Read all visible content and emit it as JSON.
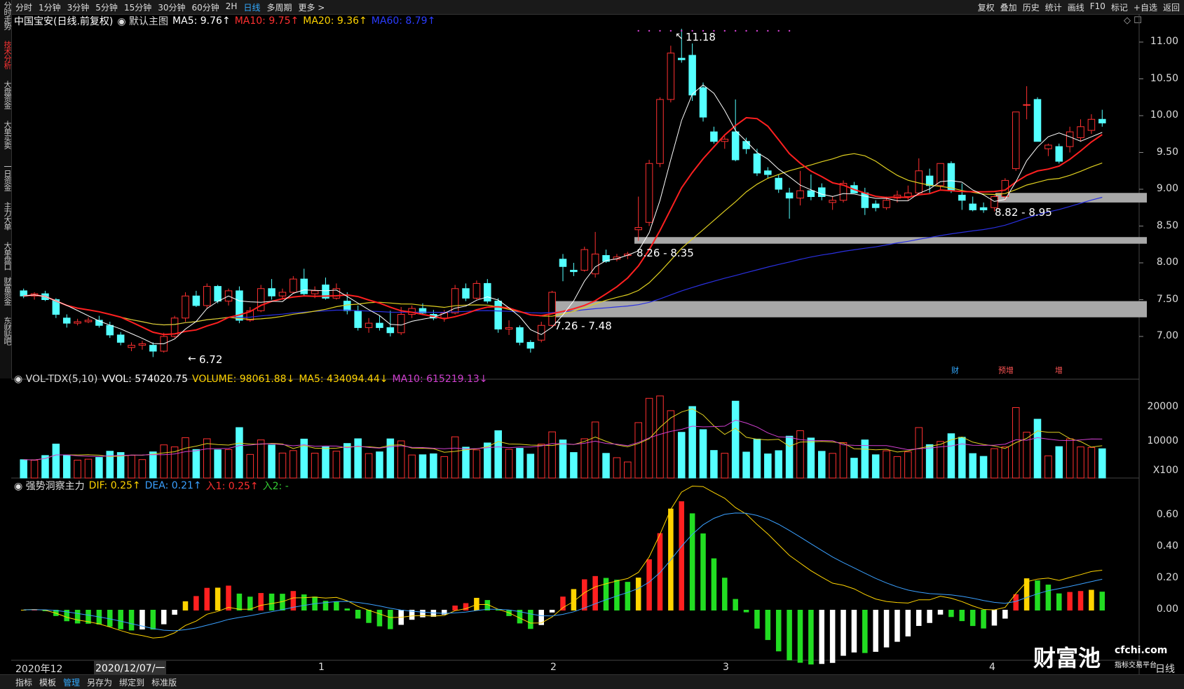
{
  "toolbar": {
    "periods": [
      "分时",
      "1分钟",
      "3分钟",
      "5分钟",
      "15分钟",
      "30分钟",
      "60分钟",
      "2H",
      "日线",
      "多周期",
      "更多 >"
    ],
    "selected_period": "日线",
    "right_buttons": [
      "复权",
      "叠加",
      "历史",
      "统计",
      "画线",
      "F10",
      "标记",
      "+自选",
      "返回"
    ]
  },
  "side_tabs": [
    "分时走势",
    "技术分析",
    "大盘资金",
    "大单买卖",
    "一日资金",
    "主力大单",
    "大单盘口",
    "财富资金",
    "东财贴吧"
  ],
  "active_side_tab": "技术分析",
  "main_legend": {
    "title": "中国宝安(日线.前复权)",
    "template": "默认主图",
    "ma5": "MA5: 9.76↑",
    "ma10": "MA10: 9.75↑",
    "ma20": "MA20: 9.36↑",
    "ma60": "MA60: 8.79↑"
  },
  "price_axis": [
    "11.00",
    "10.50",
    "10.00",
    "9.50",
    "9.00",
    "8.50",
    "8.00",
    "7.50",
    "7.00"
  ],
  "annotations": {
    "high": "11.18",
    "low": "6.72",
    "zone1": "8.82 - 8.95",
    "zone2": "8.26 - 8.35",
    "zone3": "7.26 - 7.48"
  },
  "event_tags": [
    "财",
    "预增",
    "增"
  ],
  "volume_legend": {
    "name": "VOL-TDX(5,10)",
    "vvol": "VVOL: 574020.75",
    "volume": "VOLUME: 98061.88↓",
    "ma5": "MA5: 434094.44↓",
    "ma10": "MA10: 615219.13↓"
  },
  "volume_axis": [
    "20000",
    "10000",
    "X100"
  ],
  "indicator_legend": {
    "name": "强势洞察主力",
    "dif": "DIF: 0.25↑",
    "dea": "DEA: 0.21↑",
    "in1": "入1: 0.25↑",
    "in2": "入2: -"
  },
  "indicator_axis": [
    "0.60",
    "0.40",
    "0.20",
    "0.00"
  ],
  "x_axis": {
    "labels": [
      "2020年12",
      "1",
      "2",
      "3",
      "4"
    ],
    "cursor_date": "2020/12/07/一",
    "right_label": "日线"
  },
  "bottom_tabs": [
    "指标",
    "模板",
    "管理",
    "另存为",
    "绑定到",
    "标准版"
  ],
  "selected_bottom_tab": "管理",
  "watermark": {
    "brand": "财富池",
    "domain": "cfchi.com",
    "slogan": "指标交易平台"
  },
  "colors": {
    "up": "#ff3030",
    "down": "#54ffff",
    "ma5": "#ffffff",
    "ma10": "#ff2020",
    "ma20": "#e0d020",
    "ma60": "#2a30e0",
    "zone": "#a8a8a8"
  },
  "chart_data": {
    "type": "candlestick",
    "candles": [
      [
        7.62,
        7.65,
        7.52,
        7.55
      ],
      [
        7.55,
        7.6,
        7.5,
        7.58
      ],
      [
        7.58,
        7.62,
        7.48,
        7.5
      ],
      [
        7.5,
        7.52,
        7.25,
        7.3
      ],
      [
        7.25,
        7.3,
        7.12,
        7.18
      ],
      [
        7.18,
        7.24,
        7.15,
        7.2
      ],
      [
        7.2,
        7.26,
        7.18,
        7.22
      ],
      [
        7.22,
        7.28,
        7.12,
        7.15
      ],
      [
        7.15,
        7.2,
        6.98,
        7.02
      ],
      [
        7.02,
        7.06,
        6.88,
        6.92
      ],
      [
        6.85,
        6.92,
        6.8,
        6.88
      ],
      [
        6.88,
        6.94,
        6.82,
        6.9
      ],
      [
        6.88,
        6.92,
        6.72,
        6.8
      ],
      [
        6.8,
        7.05,
        6.78,
        7.0
      ],
      [
        7.0,
        7.28,
        6.98,
        7.25
      ],
      [
        7.25,
        7.6,
        7.2,
        7.55
      ],
      [
        7.55,
        7.62,
        7.4,
        7.42
      ],
      [
        7.42,
        7.72,
        7.38,
        7.68
      ],
      [
        7.68,
        7.7,
        7.45,
        7.48
      ],
      [
        7.48,
        7.65,
        7.42,
        7.62
      ],
      [
        7.62,
        7.68,
        7.18,
        7.22
      ],
      [
        7.22,
        7.4,
        7.2,
        7.35
      ],
      [
        7.35,
        7.7,
        7.33,
        7.65
      ],
      [
        7.65,
        7.78,
        7.5,
        7.55
      ],
      [
        7.55,
        7.65,
        7.5,
        7.6
      ],
      [
        7.6,
        7.82,
        7.58,
        7.78
      ],
      [
        7.78,
        7.92,
        7.55,
        7.58
      ],
      [
        7.58,
        7.68,
        7.52,
        7.62
      ],
      [
        7.7,
        7.8,
        7.5,
        7.52
      ],
      [
        7.52,
        7.72,
        7.5,
        7.65
      ],
      [
        7.48,
        7.6,
        7.3,
        7.35
      ],
      [
        7.35,
        7.42,
        7.08,
        7.12
      ],
      [
        7.12,
        7.25,
        7.05,
        7.18
      ],
      [
        7.18,
        7.28,
        7.08,
        7.12
      ],
      [
        7.12,
        7.35,
        7.0,
        7.05
      ],
      [
        7.05,
        7.4,
        7.02,
        7.3
      ],
      [
        7.3,
        7.42,
        7.25,
        7.38
      ],
      [
        7.38,
        7.45,
        7.3,
        7.32
      ],
      [
        7.3,
        7.36,
        7.22,
        7.25
      ],
      [
        7.25,
        7.36,
        7.2,
        7.32
      ],
      [
        7.32,
        7.7,
        7.3,
        7.65
      ],
      [
        7.65,
        7.72,
        7.48,
        7.52
      ],
      [
        7.52,
        7.76,
        7.5,
        7.72
      ],
      [
        7.72,
        7.78,
        7.45,
        7.48
      ],
      [
        7.48,
        7.52,
        7.05,
        7.1
      ],
      [
        7.1,
        7.22,
        7.02,
        7.12
      ],
      [
        7.12,
        7.15,
        6.88,
        6.92
      ],
      [
        6.92,
        6.95,
        6.78,
        6.84
      ],
      [
        6.95,
        7.2,
        6.92,
        7.15
      ],
      [
        7.15,
        7.62,
        7.12,
        7.6
      ],
      [
        8.05,
        8.12,
        7.75,
        7.95
      ],
      [
        7.9,
        8.0,
        7.82,
        7.88
      ],
      [
        7.9,
        8.22,
        7.88,
        8.18
      ],
      [
        7.85,
        8.42,
        7.8,
        8.12
      ],
      [
        8.1,
        8.18,
        8.0,
        8.02
      ],
      [
        8.05,
        8.12,
        8.02,
        8.08
      ],
      [
        8.1,
        8.15,
        8.05,
        8.12
      ],
      [
        8.45,
        8.9,
        8.3,
        8.48
      ],
      [
        8.55,
        9.4,
        8.5,
        9.35
      ],
      [
        9.35,
        10.25,
        9.3,
        10.22
      ],
      [
        10.22,
        10.95,
        10.18,
        10.85
      ],
      [
        10.78,
        11.18,
        10.72,
        10.76
      ],
      [
        10.82,
        10.98,
        10.2,
        10.28
      ],
      [
        10.38,
        10.45,
        9.92,
        9.98
      ],
      [
        9.78,
        9.85,
        9.62,
        9.65
      ],
      [
        9.65,
        9.72,
        9.55,
        9.68
      ],
      [
        9.78,
        10.22,
        9.38,
        9.4
      ],
      [
        9.65,
        9.7,
        9.48,
        9.55
      ],
      [
        9.48,
        9.55,
        9.18,
        9.22
      ],
      [
        9.25,
        9.3,
        9.15,
        9.2
      ],
      [
        9.15,
        9.2,
        8.95,
        9.0
      ],
      [
        8.95,
        9.02,
        8.6,
        8.88
      ],
      [
        8.88,
        9.25,
        8.78,
        8.98
      ],
      [
        8.98,
        9.2,
        8.85,
        8.9
      ],
      [
        9.02,
        9.08,
        8.85,
        8.9
      ],
      [
        8.82,
        8.9,
        8.72,
        8.85
      ],
      [
        8.85,
        9.12,
        8.82,
        9.08
      ],
      [
        9.05,
        9.1,
        8.95,
        8.95
      ],
      [
        8.95,
        9.02,
        8.65,
        8.75
      ],
      [
        8.8,
        8.85,
        8.7,
        8.75
      ],
      [
        8.75,
        8.9,
        8.72,
        8.85
      ],
      [
        8.88,
        8.98,
        8.82,
        8.92
      ],
      [
        8.9,
        9.05,
        8.85,
        8.95
      ],
      [
        8.95,
        9.42,
        8.92,
        9.25
      ],
      [
        9.18,
        9.28,
        8.95,
        9.05
      ],
      [
        9.05,
        9.35,
        9.0,
        9.35
      ],
      [
        9.35,
        9.38,
        8.95,
        8.98
      ],
      [
        8.92,
        9.08,
        8.72,
        8.85
      ],
      [
        8.8,
        8.9,
        8.7,
        8.72
      ],
      [
        8.75,
        8.82,
        8.68,
        8.72
      ],
      [
        8.75,
        8.92,
        8.7,
        8.9
      ],
      [
        8.9,
        9.15,
        8.85,
        9.12
      ],
      [
        9.28,
        10.05,
        9.25,
        10.05
      ],
      [
        10.15,
        10.4,
        9.95,
        10.15
      ],
      [
        10.22,
        10.25,
        9.65,
        9.65
      ],
      [
        9.55,
        9.62,
        9.45,
        9.6
      ],
      [
        9.58,
        9.62,
        9.35,
        9.38
      ],
      [
        9.58,
        9.85,
        9.5,
        9.78
      ],
      [
        9.7,
        9.95,
        9.65,
        9.85
      ],
      [
        9.8,
        10.02,
        9.75,
        9.95
      ],
      [
        9.95,
        10.08,
        9.85,
        9.9
      ]
    ],
    "volume_up_color": "#ff3030",
    "volume_down_color": "#54ffff"
  }
}
